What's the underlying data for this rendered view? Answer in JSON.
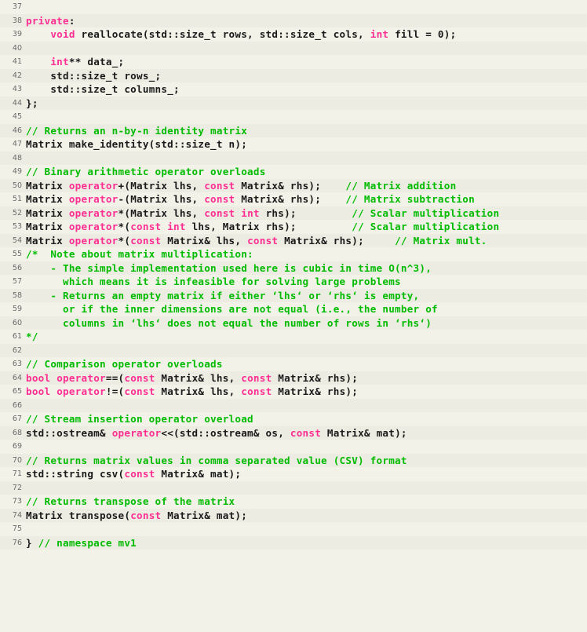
{
  "document": {
    "kind": "source-code-listing",
    "language": "C++",
    "theme": {
      "background": "#f2f2e9",
      "stripe_background": "#edece2",
      "plain_text": "#1a1a1a",
      "keyword": "#ff2e92",
      "comment": "#00bb00",
      "line_number": "#6b6b6b"
    },
    "first_line_number": 37,
    "last_line_number": 76
  },
  "lines": [
    {
      "num": "37",
      "tokens": []
    },
    {
      "num": "38",
      "tokens": [
        {
          "t": "k",
          "s": "private"
        },
        {
          "t": "pl",
          "s": ":"
        }
      ]
    },
    {
      "num": "39",
      "tokens": [
        {
          "t": "pl",
          "s": "    "
        },
        {
          "t": "k",
          "s": "void"
        },
        {
          "t": "pl",
          "s": " reallocate(std::size_t rows, std::size_t cols, "
        },
        {
          "t": "k",
          "s": "int"
        },
        {
          "t": "pl",
          "s": " fill = 0);"
        }
      ]
    },
    {
      "num": "40",
      "tokens": []
    },
    {
      "num": "41",
      "tokens": [
        {
          "t": "pl",
          "s": "    "
        },
        {
          "t": "k",
          "s": "int"
        },
        {
          "t": "pl",
          "s": "** data_;"
        }
      ]
    },
    {
      "num": "42",
      "tokens": [
        {
          "t": "pl",
          "s": "    std::size_t rows_;"
        }
      ]
    },
    {
      "num": "43",
      "tokens": [
        {
          "t": "pl",
          "s": "    std::size_t columns_;"
        }
      ]
    },
    {
      "num": "44",
      "tokens": [
        {
          "t": "pl",
          "s": "};"
        }
      ]
    },
    {
      "num": "45",
      "tokens": []
    },
    {
      "num": "46",
      "tokens": [
        {
          "t": "cm",
          "s": "// Returns an n-by-n identity matrix"
        }
      ]
    },
    {
      "num": "47",
      "tokens": [
        {
          "t": "pl",
          "s": "Matrix make_identity(std::size_t n);"
        }
      ]
    },
    {
      "num": "48",
      "tokens": []
    },
    {
      "num": "49",
      "tokens": [
        {
          "t": "cm",
          "s": "// Binary arithmetic operator overloads"
        }
      ]
    },
    {
      "num": "50",
      "tokens": [
        {
          "t": "pl",
          "s": "Matrix "
        },
        {
          "t": "k",
          "s": "operator"
        },
        {
          "t": "pl",
          "s": "+(Matrix lhs, "
        },
        {
          "t": "k",
          "s": "const"
        },
        {
          "t": "pl",
          "s": " Matrix& rhs);    "
        },
        {
          "t": "cm",
          "s": "// Matrix addition"
        }
      ]
    },
    {
      "num": "51",
      "tokens": [
        {
          "t": "pl",
          "s": "Matrix "
        },
        {
          "t": "k",
          "s": "operator"
        },
        {
          "t": "pl",
          "s": "-(Matrix lhs, "
        },
        {
          "t": "k",
          "s": "const"
        },
        {
          "t": "pl",
          "s": " Matrix& rhs);    "
        },
        {
          "t": "cm",
          "s": "// Matrix subtraction"
        }
      ]
    },
    {
      "num": "52",
      "tokens": [
        {
          "t": "pl",
          "s": "Matrix "
        },
        {
          "t": "k",
          "s": "operator"
        },
        {
          "t": "pl",
          "s": "*(Matrix lhs, "
        },
        {
          "t": "k",
          "s": "const"
        },
        {
          "t": "pl",
          "s": " "
        },
        {
          "t": "k",
          "s": "int"
        },
        {
          "t": "pl",
          "s": " rhs);         "
        },
        {
          "t": "cm",
          "s": "// Scalar multiplication"
        }
      ]
    },
    {
      "num": "53",
      "tokens": [
        {
          "t": "pl",
          "s": "Matrix "
        },
        {
          "t": "k",
          "s": "operator"
        },
        {
          "t": "pl",
          "s": "*("
        },
        {
          "t": "k",
          "s": "const"
        },
        {
          "t": "pl",
          "s": " "
        },
        {
          "t": "k",
          "s": "int"
        },
        {
          "t": "pl",
          "s": " lhs, Matrix rhs);         "
        },
        {
          "t": "cm",
          "s": "// Scalar multiplication"
        }
      ]
    },
    {
      "num": "54",
      "tokens": [
        {
          "t": "pl",
          "s": "Matrix "
        },
        {
          "t": "k",
          "s": "operator"
        },
        {
          "t": "pl",
          "s": "*("
        },
        {
          "t": "k",
          "s": "const"
        },
        {
          "t": "pl",
          "s": " Matrix& lhs, "
        },
        {
          "t": "k",
          "s": "const"
        },
        {
          "t": "pl",
          "s": " Matrix& rhs);     "
        },
        {
          "t": "cm",
          "s": "// Matrix mult."
        }
      ]
    },
    {
      "num": "55",
      "tokens": [
        {
          "t": "cm",
          "s": "/*  Note about matrix multiplication:"
        }
      ]
    },
    {
      "num": "56",
      "tokens": [
        {
          "t": "cm",
          "s": "    - The simple implementation used here is cubic in time O(n^3),"
        }
      ]
    },
    {
      "num": "57",
      "tokens": [
        {
          "t": "cm",
          "s": "      which means it is infeasible for solving large problems"
        }
      ]
    },
    {
      "num": "58",
      "tokens": [
        {
          "t": "cm",
          "s": "    - Returns an empty matrix if either ‘lhs‘ or ‘rhs‘ is empty,"
        }
      ]
    },
    {
      "num": "59",
      "tokens": [
        {
          "t": "cm",
          "s": "      or if the inner dimensions are not equal (i.e., the number of"
        }
      ]
    },
    {
      "num": "60",
      "tokens": [
        {
          "t": "cm",
          "s": "      columns in ‘lhs‘ does not equal the number of rows in ‘rhs‘)"
        }
      ]
    },
    {
      "num": "61",
      "tokens": [
        {
          "t": "cm",
          "s": "*/"
        }
      ]
    },
    {
      "num": "62",
      "tokens": []
    },
    {
      "num": "63",
      "tokens": [
        {
          "t": "cm",
          "s": "// Comparison operator overloads"
        }
      ]
    },
    {
      "num": "64",
      "tokens": [
        {
          "t": "k",
          "s": "bool"
        },
        {
          "t": "pl",
          "s": " "
        },
        {
          "t": "k",
          "s": "operator"
        },
        {
          "t": "pl",
          "s": "==("
        },
        {
          "t": "k",
          "s": "const"
        },
        {
          "t": "pl",
          "s": " Matrix& lhs, "
        },
        {
          "t": "k",
          "s": "const"
        },
        {
          "t": "pl",
          "s": " Matrix& rhs);"
        }
      ]
    },
    {
      "num": "65",
      "tokens": [
        {
          "t": "k",
          "s": "bool"
        },
        {
          "t": "pl",
          "s": " "
        },
        {
          "t": "k",
          "s": "operator"
        },
        {
          "t": "pl",
          "s": "!=("
        },
        {
          "t": "k",
          "s": "const"
        },
        {
          "t": "pl",
          "s": " Matrix& lhs, "
        },
        {
          "t": "k",
          "s": "const"
        },
        {
          "t": "pl",
          "s": " Matrix& rhs);"
        }
      ]
    },
    {
      "num": "66",
      "tokens": []
    },
    {
      "num": "67",
      "tokens": [
        {
          "t": "cm",
          "s": "// Stream insertion operator overload"
        }
      ]
    },
    {
      "num": "68",
      "tokens": [
        {
          "t": "pl",
          "s": "std::ostream& "
        },
        {
          "t": "k",
          "s": "operator"
        },
        {
          "t": "pl",
          "s": "<<(std::ostream& os, "
        },
        {
          "t": "k",
          "s": "const"
        },
        {
          "t": "pl",
          "s": " Matrix& mat);"
        }
      ]
    },
    {
      "num": "69",
      "tokens": []
    },
    {
      "num": "70",
      "tokens": [
        {
          "t": "cm",
          "s": "// Returns matrix values in comma separated value (CSV) format"
        }
      ]
    },
    {
      "num": "71",
      "tokens": [
        {
          "t": "pl",
          "s": "std::string csv("
        },
        {
          "t": "k",
          "s": "const"
        },
        {
          "t": "pl",
          "s": " Matrix& mat);"
        }
      ]
    },
    {
      "num": "72",
      "tokens": []
    },
    {
      "num": "73",
      "tokens": [
        {
          "t": "cm",
          "s": "// Returns transpose of the matrix"
        }
      ]
    },
    {
      "num": "74",
      "tokens": [
        {
          "t": "pl",
          "s": "Matrix transpose("
        },
        {
          "t": "k",
          "s": "const"
        },
        {
          "t": "pl",
          "s": " Matrix& mat);"
        }
      ]
    },
    {
      "num": "75",
      "tokens": []
    },
    {
      "num": "76",
      "tokens": [
        {
          "t": "pl",
          "s": "} "
        },
        {
          "t": "cm",
          "s": "// namespace mv1"
        }
      ]
    }
  ]
}
